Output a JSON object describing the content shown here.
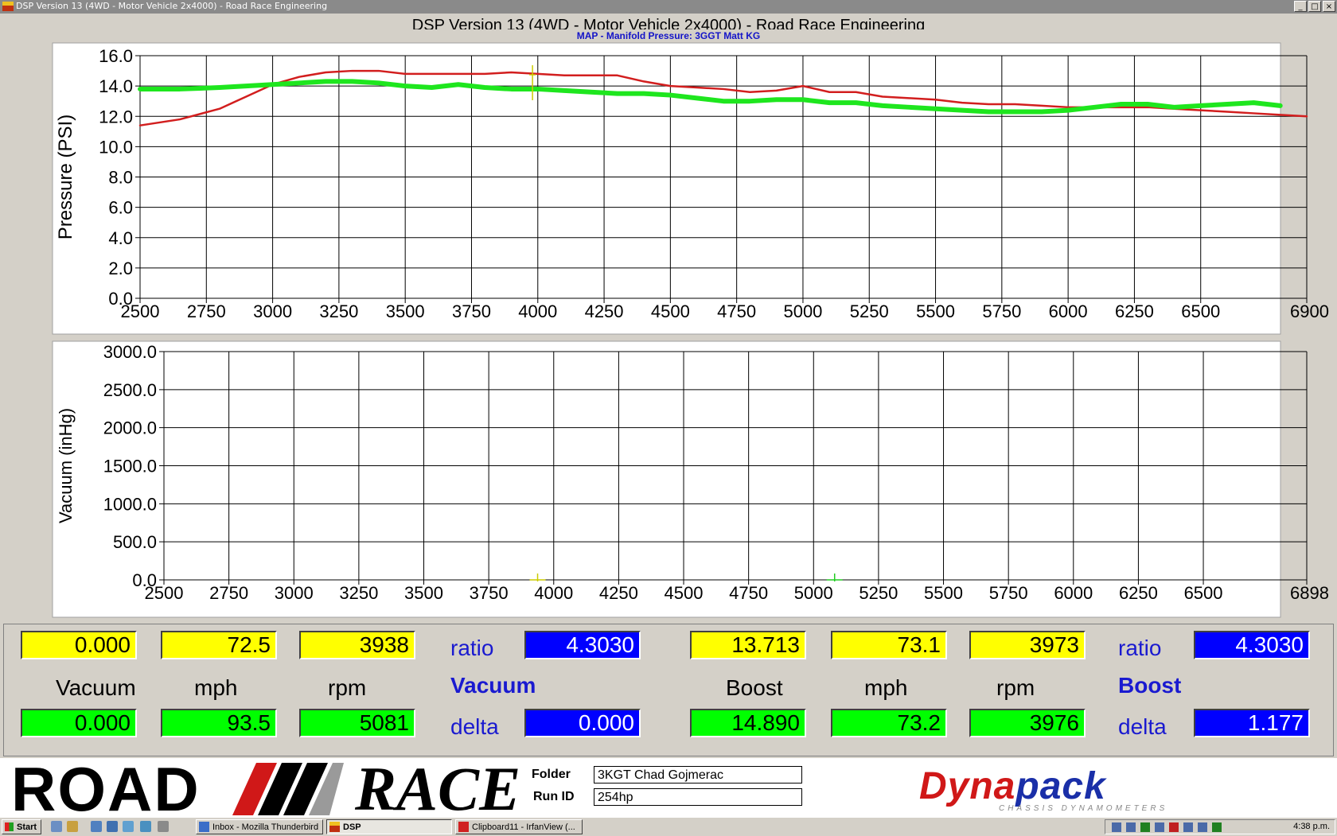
{
  "window": {
    "title": "DSP Version 13 (4WD - Motor Vehicle 2x4000) - Road Race Engineering"
  },
  "app": {
    "title": "DSP Version 13 (4WD - Motor Vehicle 2x4000) - Road Race Engineering",
    "subtitle": "MAP - Manifold Pressure: 3GGT Matt KG"
  },
  "chart_data": [
    {
      "type": "line",
      "ylabel": "Pressure (PSI)",
      "xlim": [
        2500,
        6900
      ],
      "ylim": [
        0,
        16
      ],
      "x_ticks": [
        2500,
        2750,
        3000,
        3250,
        3500,
        3750,
        4000,
        4250,
        4500,
        4750,
        5000,
        5250,
        5500,
        5750,
        6000,
        6250,
        6500,
        6900
      ],
      "x_tick_labels": [
        "2500",
        "2750",
        "3000",
        "3250",
        "3500",
        "3750",
        "4000",
        "4250",
        "4500",
        "4750",
        "5000",
        "5250",
        "5500",
        "5750",
        "6000",
        "6250",
        "6500",
        "6900"
      ],
      "y_ticks": [
        0,
        2,
        4,
        6,
        8,
        10,
        12,
        14,
        16
      ],
      "y_tick_labels": [
        "0.0",
        "2.0",
        "4.0",
        "6.0",
        "8.0",
        "10.0",
        "12.0",
        "14.0",
        "16.0"
      ],
      "grid": true,
      "cursors": [
        {
          "x": 3980,
          "color": "#cccc00"
        }
      ],
      "series": [
        {
          "color": "#d21e1e",
          "x": [
            2500,
            2650,
            2800,
            2900,
            3000,
            3100,
            3200,
            3300,
            3400,
            3500,
            3600,
            3700,
            3800,
            3900,
            4000,
            4100,
            4200,
            4300,
            4400,
            4500,
            4600,
            4700,
            4800,
            4900,
            5000,
            5100,
            5200,
            5300,
            5400,
            5500,
            5600,
            5700,
            5800,
            5900,
            6000,
            6100,
            6200,
            6300,
            6400,
            6500,
            6600,
            6700,
            6800,
            6900
          ],
          "values": [
            11.4,
            11.8,
            12.5,
            13.3,
            14.1,
            14.6,
            14.9,
            15.0,
            15.0,
            14.8,
            14.8,
            14.8,
            14.8,
            14.9,
            14.8,
            14.7,
            14.7,
            14.7,
            14.3,
            14.0,
            13.9,
            13.8,
            13.6,
            13.7,
            14.0,
            13.6,
            13.6,
            13.3,
            13.2,
            13.1,
            12.9,
            12.8,
            12.8,
            12.7,
            12.6,
            12.6,
            12.6,
            12.6,
            12.5,
            12.4,
            12.3,
            12.2,
            12.1,
            12.0
          ]
        },
        {
          "color": "#1ee61e",
          "x": [
            2500,
            2650,
            2800,
            2900,
            3000,
            3100,
            3200,
            3300,
            3400,
            3500,
            3600,
            3700,
            3800,
            3900,
            4000,
            4100,
            4200,
            4300,
            4400,
            4500,
            4600,
            4700,
            4800,
            4900,
            5000,
            5100,
            5200,
            5300,
            5400,
            5500,
            5600,
            5700,
            5800,
            5900,
            6000,
            6100,
            6200,
            6300,
            6400,
            6500,
            6600,
            6700,
            6800
          ],
          "values": [
            13.8,
            13.8,
            13.9,
            14.0,
            14.1,
            14.2,
            14.3,
            14.3,
            14.2,
            14.0,
            13.9,
            14.1,
            13.9,
            13.8,
            13.8,
            13.7,
            13.6,
            13.5,
            13.5,
            13.4,
            13.2,
            13.0,
            13.0,
            13.1,
            13.1,
            12.9,
            12.9,
            12.7,
            12.6,
            12.5,
            12.4,
            12.3,
            12.3,
            12.3,
            12.4,
            12.6,
            12.8,
            12.8,
            12.6,
            12.7,
            12.8,
            12.9,
            12.7
          ]
        }
      ]
    },
    {
      "type": "line",
      "ylabel": "Vacuum (inHg)",
      "xlim": [
        2500,
        6898
      ],
      "ylim": [
        0,
        3000
      ],
      "x_ticks": [
        2500,
        2750,
        3000,
        3250,
        3500,
        3750,
        4000,
        4250,
        4500,
        4750,
        5000,
        5250,
        5500,
        5750,
        6000,
        6250,
        6500,
        6898
      ],
      "x_tick_labels": [
        "2500",
        "2750",
        "3000",
        "3250",
        "3500",
        "3750",
        "4000",
        "4250",
        "4500",
        "4750",
        "5000",
        "5250",
        "5500",
        "5750",
        "6000",
        "6250",
        "6500",
        "6898"
      ],
      "y_ticks": [
        0,
        500,
        1000,
        1500,
        2000,
        2500,
        3000
      ],
      "y_tick_labels": [
        "0.0",
        "500.0",
        "1000.0",
        "1500.0",
        "2000.0",
        "2500.0",
        "3000.0"
      ],
      "grid": true,
      "cursors": [
        {
          "x": 3938,
          "color": "#cccc00"
        },
        {
          "x": 5081,
          "color": "#22cc22"
        }
      ],
      "series": []
    }
  ],
  "readouts": {
    "vacuum": {
      "top": [
        "0.000",
        "72.5",
        "3938"
      ],
      "bottom": [
        "0.000",
        "93.5",
        "5081"
      ],
      "ratio_label": "ratio",
      "ratio_value": "4.3030",
      "delta_label": "delta",
      "delta_value": "0.000",
      "title": "Vacuum"
    },
    "boost": {
      "top": [
        "13.713",
        "73.1",
        "3973"
      ],
      "bottom": [
        "14.890",
        "73.2",
        "3976"
      ],
      "ratio_label": "ratio",
      "ratio_value": "4.3030",
      "delta_label": "delta",
      "delta_value": "1.177",
      "title": "Boost"
    },
    "labels": {
      "vacuum": "Vacuum",
      "mph": "mph",
      "rpm": "rpm",
      "boost": "Boost"
    }
  },
  "footer": {
    "logo_left": "ROAD",
    "logo_right": "RACE",
    "folder_label": "Folder",
    "folder_value": "3KGT Chad Gojmerac",
    "runid_label": "Run ID",
    "runid_value": "254hp",
    "brand": "Dyna",
    "brand2": "pack",
    "brand_sub": "CHASSIS DYNAMOMETERS"
  },
  "taskbar": {
    "start": "Start",
    "tasks": [
      "Inbox - Mozilla Thunderbird",
      "DSP",
      "Clipboard11 - IrfanView (..."
    ],
    "clock": "4:38 p.m."
  }
}
